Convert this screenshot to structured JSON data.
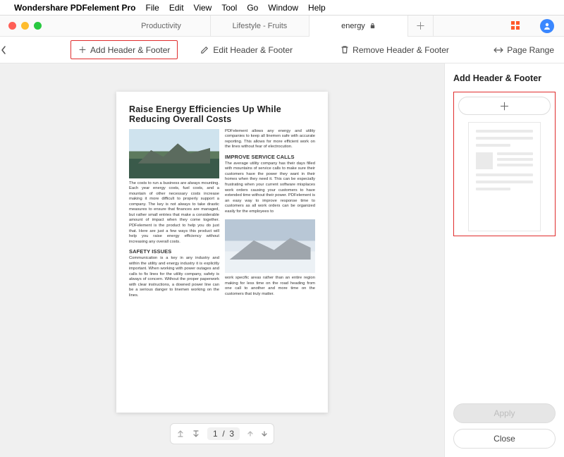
{
  "menubar": {
    "app_name": "Wondershare PDFelement Pro",
    "items": [
      "File",
      "Edit",
      "View",
      "Tool",
      "Go",
      "Window",
      "Help"
    ]
  },
  "tabs": {
    "items": [
      {
        "label": "Productivity"
      },
      {
        "label": "Lifestyle - Fruits"
      },
      {
        "label": "energy",
        "locked": true,
        "active": true
      }
    ]
  },
  "toolbar": {
    "add_hf": "Add Header & Footer",
    "edit_hf": "Edit Header & Footer",
    "remove_hf": "Remove Header & Footer",
    "page_range": "Page Range"
  },
  "document": {
    "title": "Raise Energy Efficiencies Up While Reducing Overall Costs",
    "left_col": {
      "p1": "The costs to run a business are always mounting. Each year energy costs, fuel costs, and a mountain of other necessary costs increase making it more difficult to properly support a company. The key is not always to take drastic measures to ensure that finances are managed, but rather small entries that make a considerable amount of impact when they come together. PDFelement is the product to help you do just that. Here are just a few ways this product will help you raise energy efficiency without increasing any overall costs.",
      "sub1": "SAFETY ISSUES",
      "p2": "Communication is a key in any industry and within the utility and energy industry it is explicitly important. When working with power outages and calls to fix lines for the utility company, safety is always of concern. Without the proper paperwork with clear instructions, a downed power line can be a serious danger to linemen working on the lines."
    },
    "right_col": {
      "p1": "PDFelement allows any energy and utility companies to keep all linemen safe with accurate reporting. This allows for more efficient work on the lines without fear of electrocution.",
      "sub1": "IMPROVE SERVICE CALLS",
      "p2": "The average utility company has their days filled with mountains of service calls to make sure their customers have the power they want in their homes when they need it. This can be especially frustrating when your current software misplaces work orders causing your customers to have extended time without their power. PDFelement is an easy way to improve response time to customers as all work orders can be organized easily for the employees to",
      "p3": "work specific areas rather than an entire region making for less time on the road heading from one call to another and more time on the customers that truly matter."
    }
  },
  "page_nav": {
    "current": "1",
    "sep": "/",
    "total": "3"
  },
  "side_panel": {
    "title": "Add Header & Footer",
    "apply": "Apply",
    "close": "Close"
  }
}
